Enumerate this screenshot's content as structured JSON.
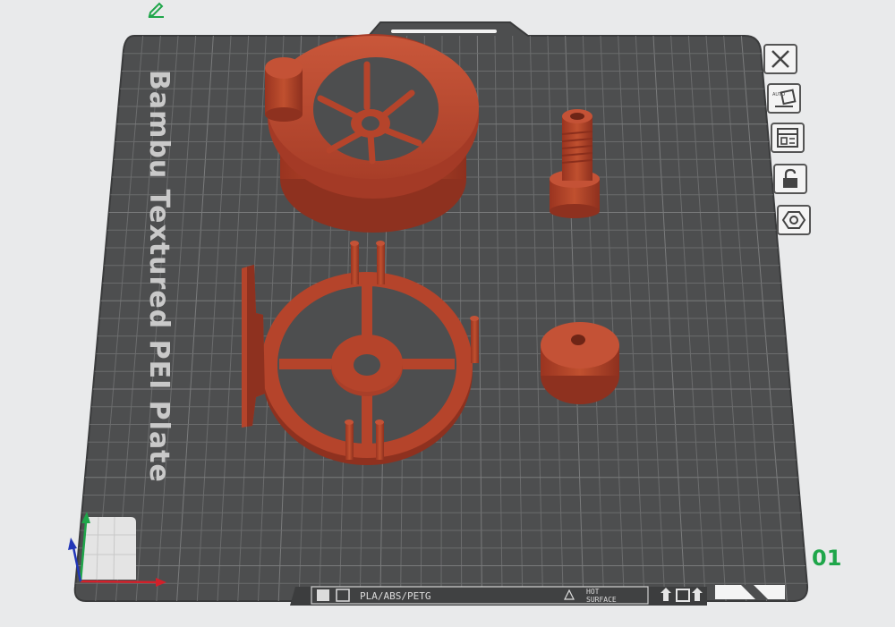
{
  "plate": {
    "name": "Bambu Textured PEI Plate",
    "number": "01"
  },
  "bottom_bar": {
    "material": "PLA/ABS/PETG",
    "warning_line1": "HOT",
    "warning_line2": "SURFACE"
  },
  "toolbar": {
    "buttons": [
      {
        "name": "close-icon"
      },
      {
        "name": "auto-orient-icon",
        "label": "AUTO"
      },
      {
        "name": "arrange-icon"
      },
      {
        "name": "lock-icon"
      },
      {
        "name": "plate-settings-icon"
      }
    ]
  },
  "colors": {
    "plate": "#4d4e4f",
    "grid": "#6b6c6d",
    "model": "#b5442b",
    "plate_number": "#1fa64a",
    "axis_x": "#d3202a",
    "axis_y": "#1fa64a",
    "axis_z": "#2236b8"
  }
}
